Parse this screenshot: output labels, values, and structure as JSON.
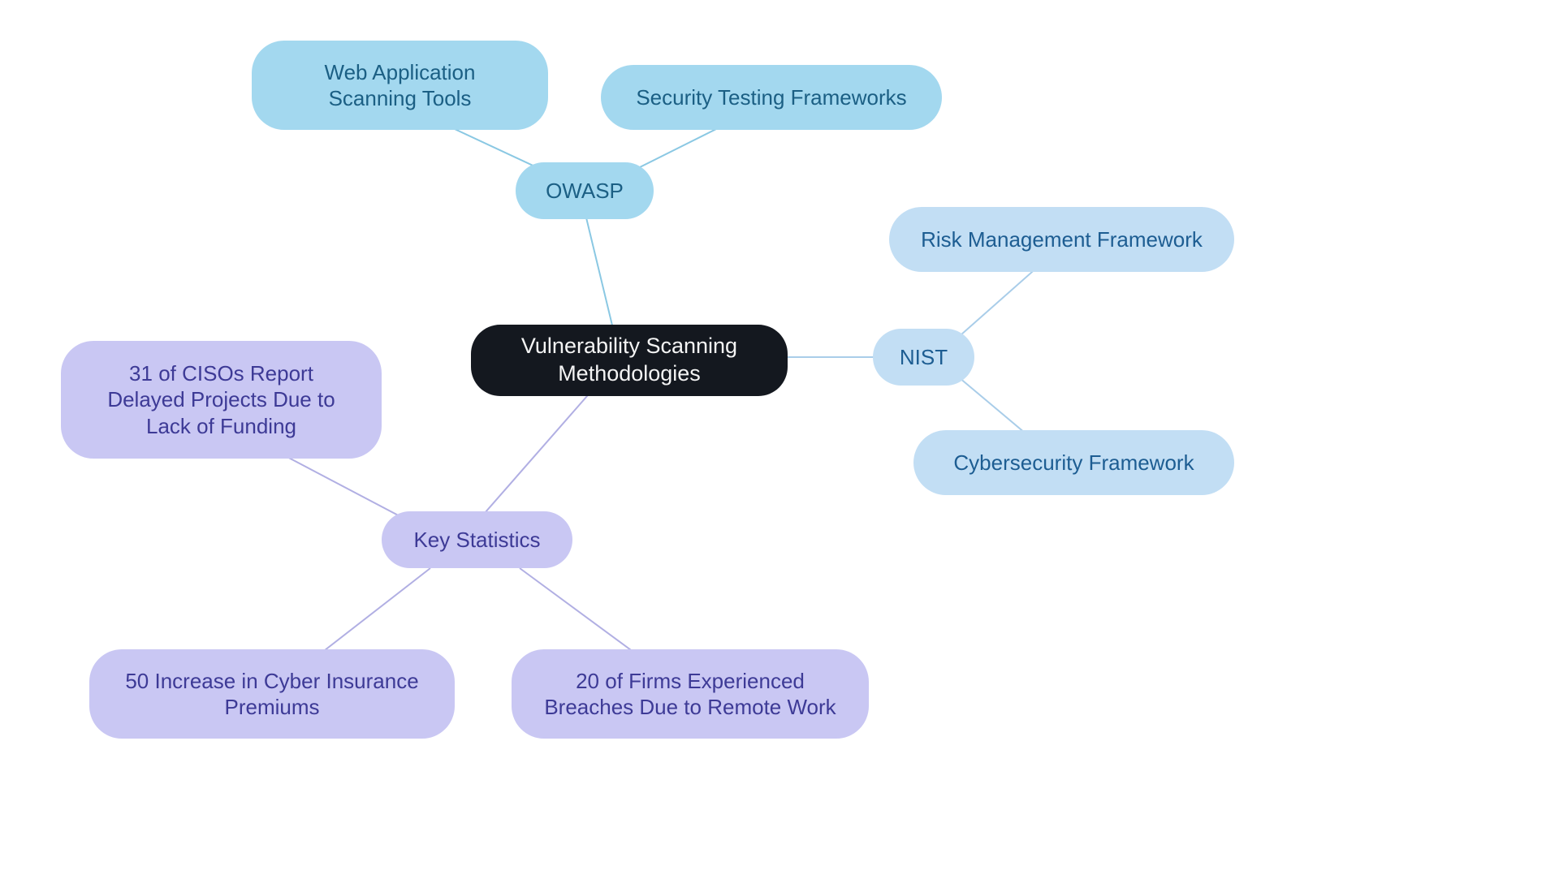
{
  "root": {
    "label": "Vulnerability Scanning Methodologies"
  },
  "owasp": {
    "label": "OWASP",
    "children": [
      {
        "label": "Web Application Scanning Tools"
      },
      {
        "label": "Security Testing Frameworks"
      }
    ]
  },
  "nist": {
    "label": "NIST",
    "children": [
      {
        "label": "Risk Management Framework"
      },
      {
        "label": "Cybersecurity Framework"
      }
    ]
  },
  "stats": {
    "label": "Key Statistics",
    "children": [
      {
        "label": "31 of CISOs Report Delayed Projects Due to Lack of Funding"
      },
      {
        "label": "50 Increase in Cyber Insurance Premiums"
      },
      {
        "label": "20 of Firms Experienced Breaches Due to Remote Work"
      }
    ]
  },
  "colors": {
    "owasp_line": "#8ac8e3",
    "nist_line": "#a9cde9",
    "stats_line": "#b1afe3"
  }
}
